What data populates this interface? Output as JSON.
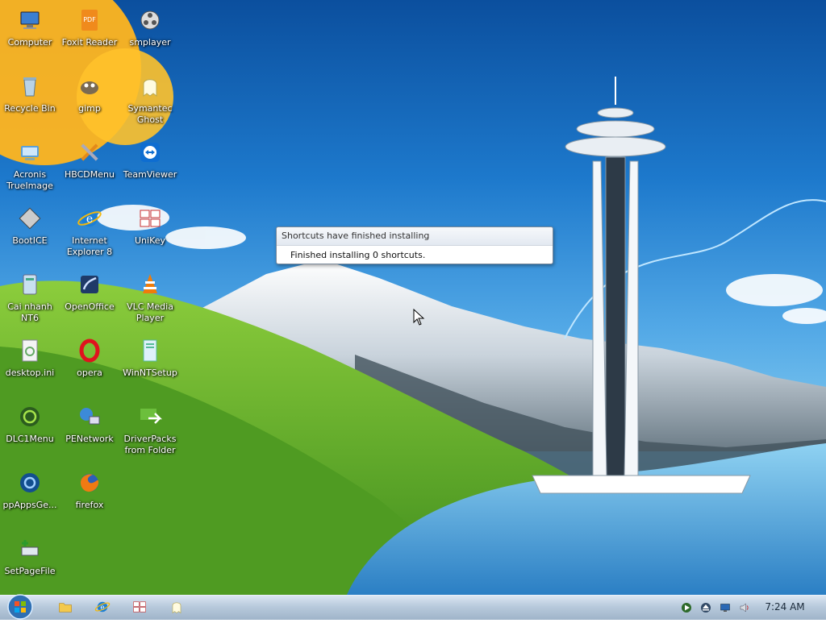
{
  "desktop": {
    "icons": [
      {
        "label": "Computer",
        "icon": "computer-icon"
      },
      {
        "label": "Foxit Reader",
        "icon": "pdf-icon"
      },
      {
        "label": "smplayer",
        "icon": "film-reel-icon"
      },
      {
        "label": "Recycle Bin",
        "icon": "recycle-bin-icon"
      },
      {
        "label": "gimp",
        "icon": "gimp-icon"
      },
      {
        "label": "Symantec\nGhost",
        "icon": "ghost-icon"
      },
      {
        "label": "Acronis\nTrueImage",
        "icon": "acronis-icon"
      },
      {
        "label": "HBCDMenu",
        "icon": "tools-icon"
      },
      {
        "label": "TeamViewer",
        "icon": "teamviewer-icon"
      },
      {
        "label": "BootICE",
        "icon": "bootice-icon"
      },
      {
        "label": "Internet\nExplorer 8",
        "icon": "internet-explorer-icon"
      },
      {
        "label": "UniKey",
        "icon": "unikey-icon"
      },
      {
        "label": "Cai nhanh\nNT6",
        "icon": "installer-icon"
      },
      {
        "label": "OpenOffice",
        "icon": "openoffice-icon"
      },
      {
        "label": "VLC Media\nPlayer",
        "icon": "vlc-cone-icon"
      },
      {
        "label": "desktop.ini",
        "icon": "settings-file-icon"
      },
      {
        "label": "opera",
        "icon": "opera-icon"
      },
      {
        "label": "WinNTSetup",
        "icon": "setup-icon"
      },
      {
        "label": "DLC1Menu",
        "icon": "dlc-icon"
      },
      {
        "label": "PENetwork",
        "icon": "network-icon"
      },
      {
        "label": "DriverPacks\nfrom Folder",
        "icon": "driverpacks-icon"
      },
      {
        "label": "ppAppsGe...",
        "icon": "ppapps-icon"
      },
      {
        "label": "firefox",
        "icon": "firefox-icon"
      },
      {
        "label": "SetPageFile",
        "icon": "pagefile-icon"
      }
    ]
  },
  "notification": {
    "title": "Shortcuts have finished installing",
    "message": "Finished installing 0 shortcuts."
  },
  "taskbar": {
    "start_icon": "windows-start-icon",
    "pinned": [
      {
        "icon": "folder-icon"
      },
      {
        "icon": "internet-explorer-icon"
      },
      {
        "icon": "unikey-icon"
      },
      {
        "icon": "ghost-icon"
      }
    ],
    "tray": [
      {
        "icon": "play-icon"
      },
      {
        "icon": "eject-icon"
      },
      {
        "icon": "display-icon"
      },
      {
        "icon": "speaker-icon"
      }
    ],
    "clock": "7:24 AM"
  },
  "colors": {
    "taskbar_top": "#dbe6f2",
    "taskbar_bottom": "#9fb4c9",
    "sky": "#1d79cc",
    "grass": "#5da52a",
    "water": "#4aa6e0"
  }
}
